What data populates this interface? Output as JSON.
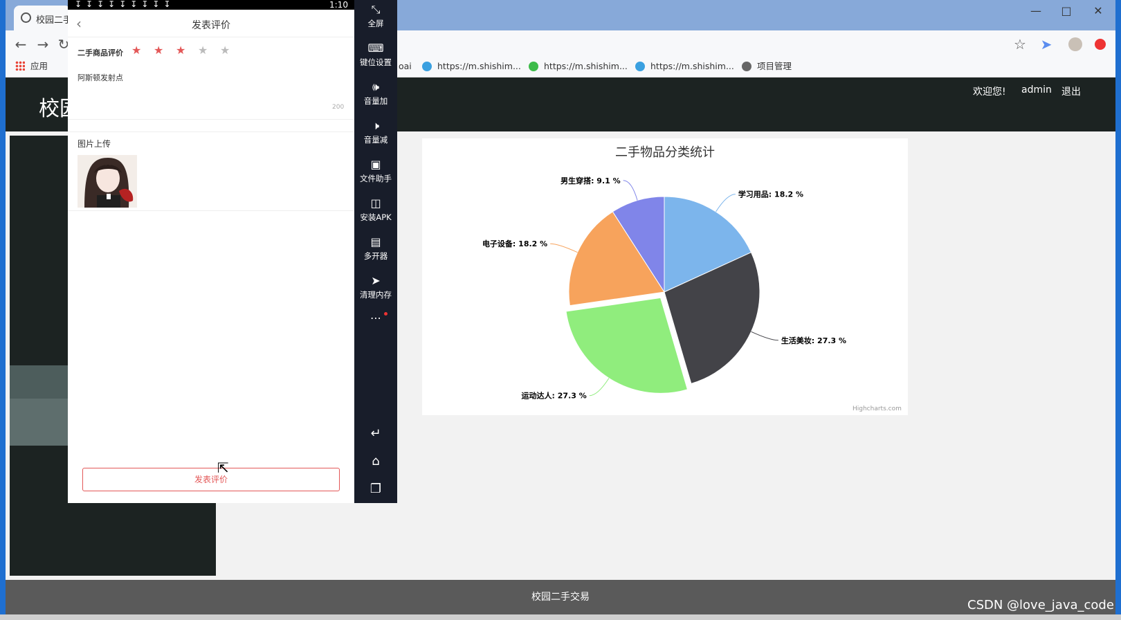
{
  "browser": {
    "tab_title": "校园二手",
    "bookmarks": [
      {
        "label": "应用"
      },
      {
        "label": "oai"
      },
      {
        "label": "https://m.shishim..."
      },
      {
        "label": "https://m.shishim..."
      },
      {
        "label": "https://m.shishim..."
      },
      {
        "label": "项目管理"
      }
    ]
  },
  "site": {
    "logo": "校园",
    "welcome": "欢迎您!",
    "user": "admin",
    "logout": "退出",
    "footer": "校园二手交易"
  },
  "chart_data": {
    "type": "pie",
    "title": "二手物品分类统计",
    "credits": "Highcharts.com",
    "series": [
      {
        "name": "学习用品",
        "value": 18.2,
        "color": "#7cb5ec"
      },
      {
        "name": "生活美妆",
        "value": 27.3,
        "color": "#434348"
      },
      {
        "name": "运动达人",
        "value": 27.3,
        "color": "#90ed7d",
        "sliced": true
      },
      {
        "name": "电子设备",
        "value": 18.2,
        "color": "#f7a35c"
      },
      {
        "name": "男生穿搭",
        "value": 9.1,
        "color": "#8085e9"
      }
    ],
    "label_suffix": " %"
  },
  "phone": {
    "status_time": "1:10",
    "title": "发表评价",
    "rating_label": "二手商品评价",
    "rating": 3,
    "rating_max": 5,
    "review_text": "阿斯顿发射点",
    "char_limit": "200",
    "upload_label": "图片上传",
    "submit_label": "发表评价"
  },
  "emulator": {
    "buttons": [
      {
        "icon": "fullscreen-icon",
        "label": "全屏"
      },
      {
        "icon": "keyboard-icon",
        "label": "键位设置"
      },
      {
        "icon": "volume-up-icon",
        "label": "音量加"
      },
      {
        "icon": "volume-down-icon",
        "label": "音量减"
      },
      {
        "icon": "file-icon",
        "label": "文件助手"
      },
      {
        "icon": "apk-icon",
        "label": "安装APK"
      },
      {
        "icon": "multi-icon",
        "label": "多开器"
      },
      {
        "icon": "rocket-icon",
        "label": "清理内存"
      }
    ]
  },
  "watermark": "CSDN @love_java_code",
  "colors": {
    "star_active": "#e35757",
    "star_inactive": "#bbbbbb",
    "header_bg": "#1c2322"
  }
}
